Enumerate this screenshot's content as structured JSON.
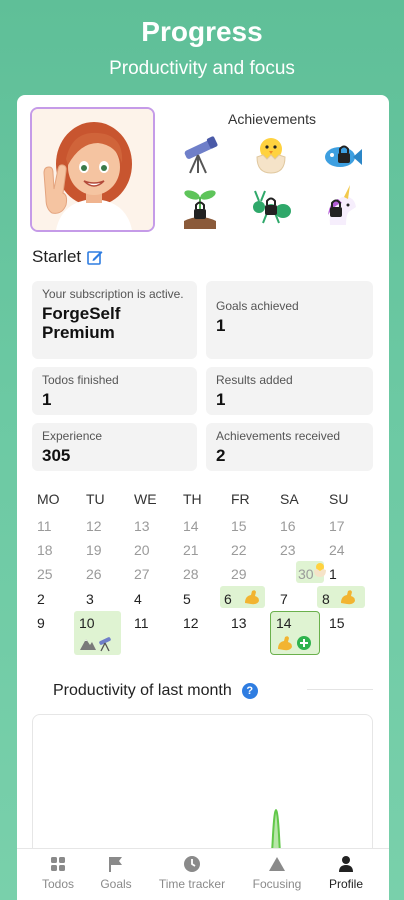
{
  "header": {
    "title": "Progress",
    "subtitle": "Productivity and focus"
  },
  "profile": {
    "username": "Starlet"
  },
  "achievements": {
    "title": "Achievements",
    "items": [
      {
        "icon": "telescope-icon",
        "locked": false
      },
      {
        "icon": "hatching-chick-icon",
        "locked": false
      },
      {
        "icon": "fish-icon",
        "locked": true
      },
      {
        "icon": "seedling-icon",
        "locked": true
      },
      {
        "icon": "ant-icon",
        "locked": true
      },
      {
        "icon": "unicorn-icon",
        "locked": true
      }
    ]
  },
  "stats": {
    "subscription_label": "Your subscription is active.",
    "subscription_value": "ForgeSelf Premium",
    "goals_label": "Goals achieved",
    "goals_value": "1",
    "todos_label": "Todos finished",
    "todos_value": "1",
    "results_label": "Results added",
    "results_value": "1",
    "experience_label": "Experience",
    "experience_value": "305",
    "ach_received_label": "Achievements received",
    "ach_received_value": "2"
  },
  "calendar": {
    "weekdays": [
      "MO",
      "TU",
      "WE",
      "TH",
      "FR",
      "SA",
      "SU"
    ],
    "rows": [
      [
        "11",
        "12",
        "13",
        "14",
        "15",
        "16",
        "17"
      ],
      [
        "18",
        "19",
        "20",
        "21",
        "22",
        "23",
        "24"
      ],
      [
        "25",
        "26",
        "27",
        "28",
        "29",
        "30",
        "1"
      ],
      [
        "2",
        "3",
        "4",
        "5",
        "6",
        "7",
        "8"
      ],
      [
        "9",
        "10",
        "11",
        "12",
        "13",
        "14",
        "15"
      ]
    ]
  },
  "productivity": {
    "title": "Productivity of last month",
    "help": "?"
  },
  "nav": {
    "items": [
      {
        "label": "Todos",
        "icon": "grid-icon"
      },
      {
        "label": "Goals",
        "icon": "flag-icon"
      },
      {
        "label": "Time tracker",
        "icon": "clock-icon"
      },
      {
        "label": "Focusing",
        "icon": "triangle-icon"
      },
      {
        "label": "Profile",
        "icon": "person-icon"
      }
    ],
    "active": "Profile"
  },
  "colors": {
    "accent": "#5fbf98",
    "highlight": "#dff3d2",
    "avatar_border": "#c59be8",
    "chart_line": "#62c84a"
  }
}
